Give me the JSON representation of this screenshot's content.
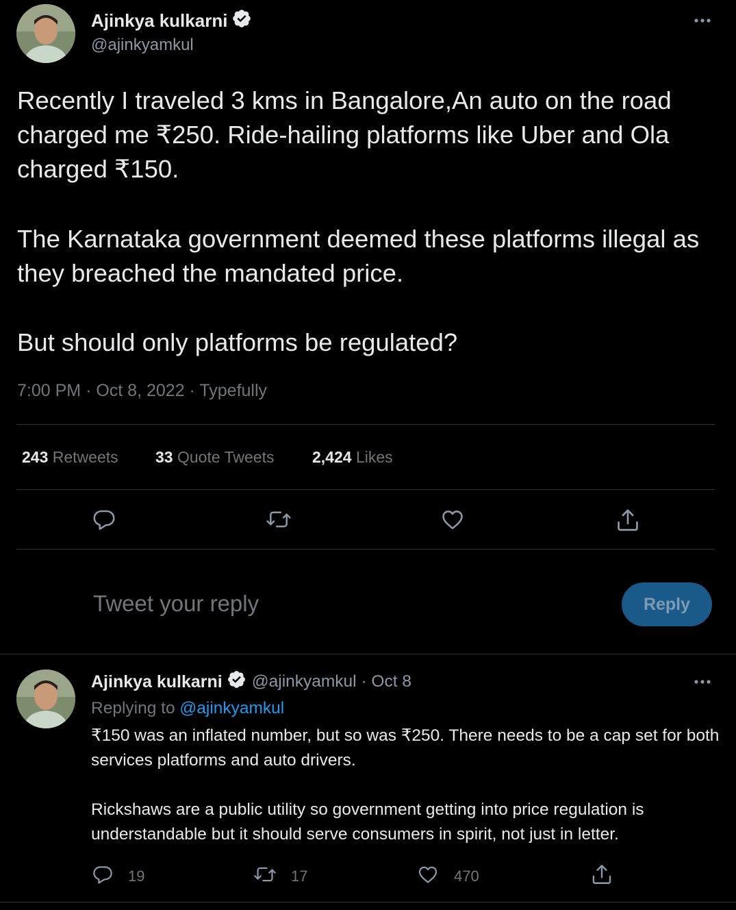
{
  "main_tweet": {
    "author_name": "Ajinkya kulkarni",
    "author_handle": "@ajinkyamkul",
    "text_p1": "Recently I traveled 3 kms in Bangalore,An auto on the road charged me ₹250. Ride-hailing platforms like Uber and Ola charged ₹150.",
    "text_p2": "The Karnataka government deemed these platforms illegal as they breached the mandated price.",
    "text_p3": "But should only platforms be regulated?",
    "time": "7:00 PM",
    "date": "Oct 8, 2022",
    "source": "Typefully",
    "separator": "·",
    "stats": {
      "retweets_count": "243",
      "retweets_label": "Retweets",
      "quotes_count": "33",
      "quotes_label": "Quote Tweets",
      "likes_count": "2,424",
      "likes_label": "Likes"
    },
    "more_icon": "more-horizontal-icon"
  },
  "reply_box": {
    "placeholder": "Tweet your reply",
    "button_label": "Reply"
  },
  "reply_tweet": {
    "author_name": "Ajinkya kulkarni",
    "author_handle": "@ajinkyamkul",
    "date": "Oct 8",
    "separator": "·",
    "replying_to_label": "Replying to",
    "replying_to_handle": "@ajinkyamkul",
    "text_p1": "₹150 was an inflated number, but so was ₹250. There needs to be a cap set for both services platforms and auto drivers.",
    "text_p2": "Rickshaws are a public utility so government getting into price regulation is understandable but it should serve consumers in spirit, not just in letter.",
    "reply_count": "19",
    "retweet_count": "17",
    "like_count": "470"
  },
  "colors": {
    "background": "#000000",
    "text_primary": "#e7e9ea",
    "text_secondary": "#71767b",
    "accent": "#1d9bf0",
    "divider": "#2f3336"
  }
}
